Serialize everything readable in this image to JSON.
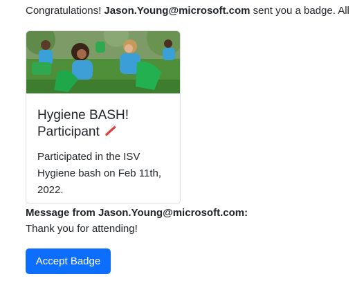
{
  "intro": {
    "prefix": "Congratulations! ",
    "sender": "Jason.Young@microsoft.com",
    "suffix": " sent you a badge. All"
  },
  "badge": {
    "title": "Hygiene BASH! Participant",
    "title_icon": "toothbrush-icon",
    "description": "Participated in the ISV Hygiene bash on Feb 11th, 2022.",
    "image": "volunteers-cleanup-photo"
  },
  "message": {
    "label": "Message from Jason.Young@microsoft.com:",
    "text": "Thank you for attending!"
  },
  "actions": {
    "accept_label": "Accept Badge"
  },
  "colors": {
    "primary": "#0d6efd",
    "text": "#212529",
    "card_border": "#dfe1e5"
  }
}
